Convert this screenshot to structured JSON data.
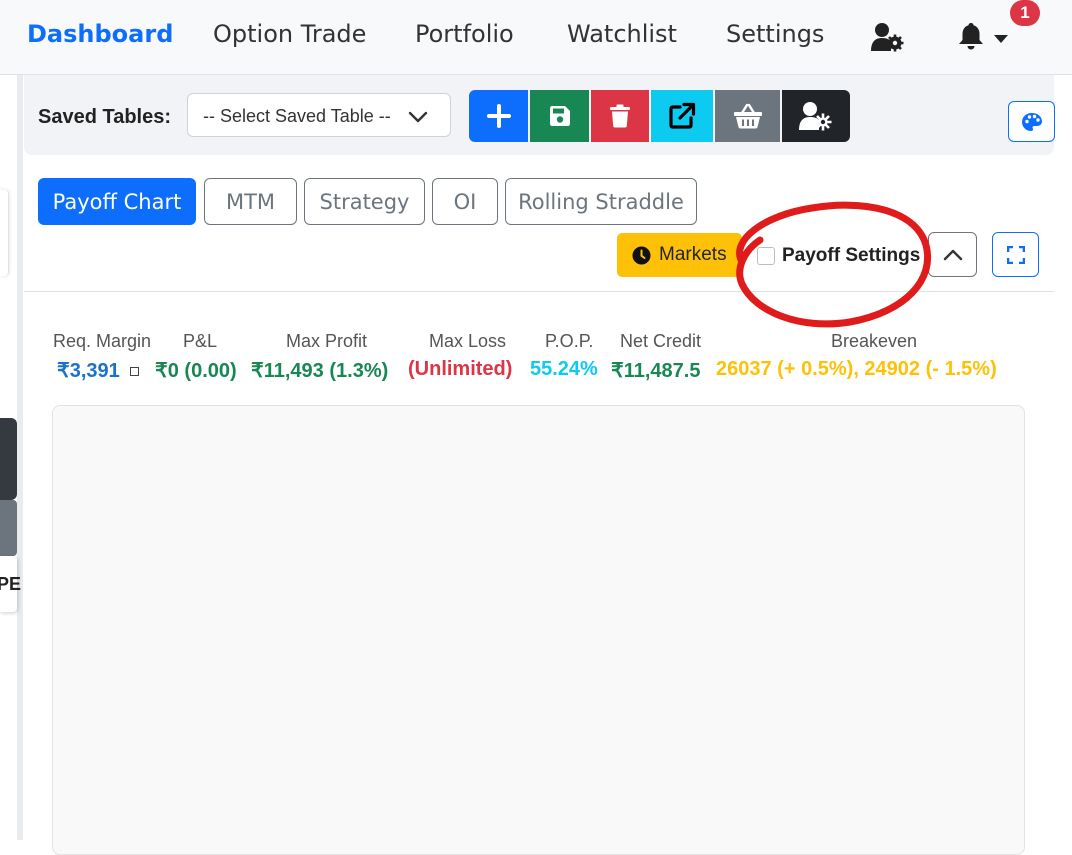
{
  "nav": {
    "items": [
      {
        "label": "Dashboard",
        "active": true
      },
      {
        "label": "Option Trade"
      },
      {
        "label": "Portfolio"
      },
      {
        "label": "Watchlist"
      },
      {
        "label": "Settings"
      }
    ],
    "icons": [
      "user-gear-icon",
      "bell-icon",
      "caret-down-icon"
    ],
    "notification_count": "1"
  },
  "sidebar": {
    "partial_text": "PE"
  },
  "toolbar": {
    "saved_tables_label": "Saved Tables:",
    "select_value": "-- Select Saved Table --",
    "buttons": [
      {
        "name": "add",
        "icon": "plus-icon",
        "color": "#0d6efd"
      },
      {
        "name": "save",
        "icon": "floppy-disk-icon",
        "color": "#198754"
      },
      {
        "name": "delete",
        "icon": "trash-icon",
        "color": "#dc3545"
      },
      {
        "name": "share",
        "icon": "external-link-icon",
        "color": "#0dcaf0"
      },
      {
        "name": "basket",
        "icon": "basket-icon",
        "color": "#6c757d"
      },
      {
        "name": "user-settings",
        "icon": "user-gear-icon",
        "color": "#212529"
      }
    ],
    "palette_icon": "palette-icon"
  },
  "tabs": [
    {
      "label": "Payoff Chart",
      "active": true
    },
    {
      "label": "MTM"
    },
    {
      "label": "Strategy"
    },
    {
      "label": "OI"
    },
    {
      "label": "Rolling Straddle"
    }
  ],
  "controls": {
    "markets_label": "Markets",
    "payoff_settings_label": "Payoff Settings",
    "payoff_settings_checked": false
  },
  "stats": [
    {
      "label": "Req. Margin",
      "value": "₹3,391",
      "color": "#1a73c9"
    },
    {
      "label": "P&L",
      "value": "₹0 (0.00)",
      "color": "#198754"
    },
    {
      "label": "Max Profit",
      "value": "₹11,493 (1.3%)",
      "color": "#198754"
    },
    {
      "label": "Max Loss",
      "value": "(Unlimited)",
      "color": "#dc3545"
    },
    {
      "label": "P.O.P.",
      "value": "55.24%",
      "color": "#0dcaf0"
    },
    {
      "label": "Net Credit",
      "value": "₹11,487.5",
      "color": "#198754"
    },
    {
      "label": "Breakeven",
      "value": "26037 (+ 0.5%), 24902 (- 1.5%)",
      "color": "#ffc107"
    }
  ],
  "colors": {
    "primary": "#0d6efd",
    "success": "#198754",
    "danger": "#dc3545",
    "info": "#0dcaf0",
    "warning": "#ffc107",
    "annotation": "#e01b1b"
  }
}
